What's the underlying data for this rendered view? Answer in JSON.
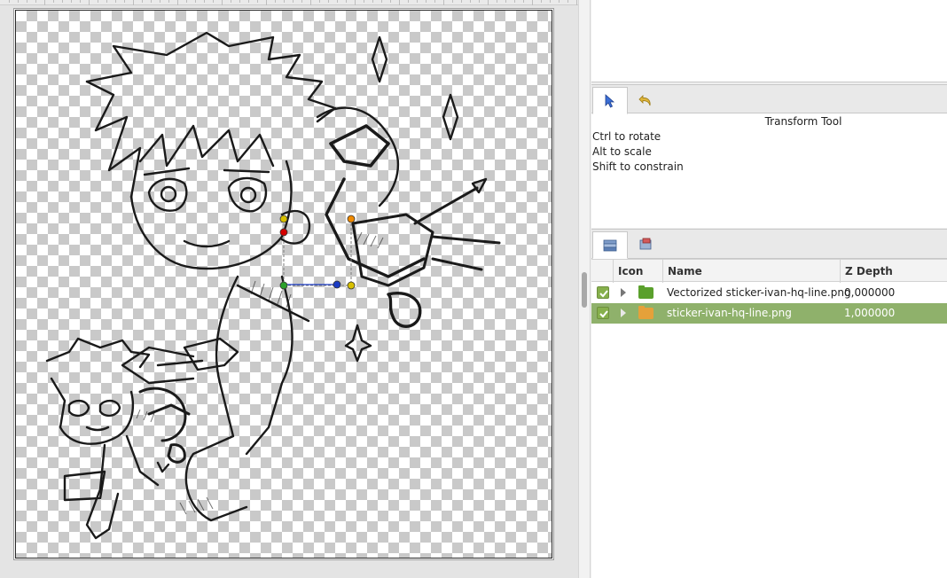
{
  "tool_panel": {
    "tabs": [
      {
        "icon": "arrow-pointer-icon",
        "active": true
      },
      {
        "icon": "undo-history-icon",
        "active": false
      }
    ],
    "title": "Transform Tool",
    "hints": [
      "Ctrl to rotate",
      "Alt to scale",
      "Shift to constrain"
    ]
  },
  "layers_panel": {
    "tabs": [
      {
        "icon": "layers-icon",
        "active": true
      },
      {
        "icon": "library-icon",
        "active": false
      }
    ],
    "columns": {
      "icon": "Icon",
      "name": "Name",
      "z_depth": "Z Depth"
    },
    "rows": [
      {
        "visible": true,
        "icon": "folder-icon",
        "icon_color": "#5aa02c",
        "name": "Vectorized sticker-ivan-hq-line.png",
        "z_depth": "0,000000",
        "selected": false
      },
      {
        "visible": true,
        "icon": "image-folder-icon",
        "icon_color": "#e5a13a",
        "name": "sticker-ivan-hq-line.png",
        "z_depth": "1,000000",
        "selected": true
      }
    ]
  },
  "colors": {
    "selection": "#8fb16b",
    "handle_red": "#d40000",
    "handle_yellow": "#d8c000",
    "handle_orange": "#f08a00",
    "handle_green": "#2aa02a",
    "handle_blue": "#1a3bc4"
  }
}
